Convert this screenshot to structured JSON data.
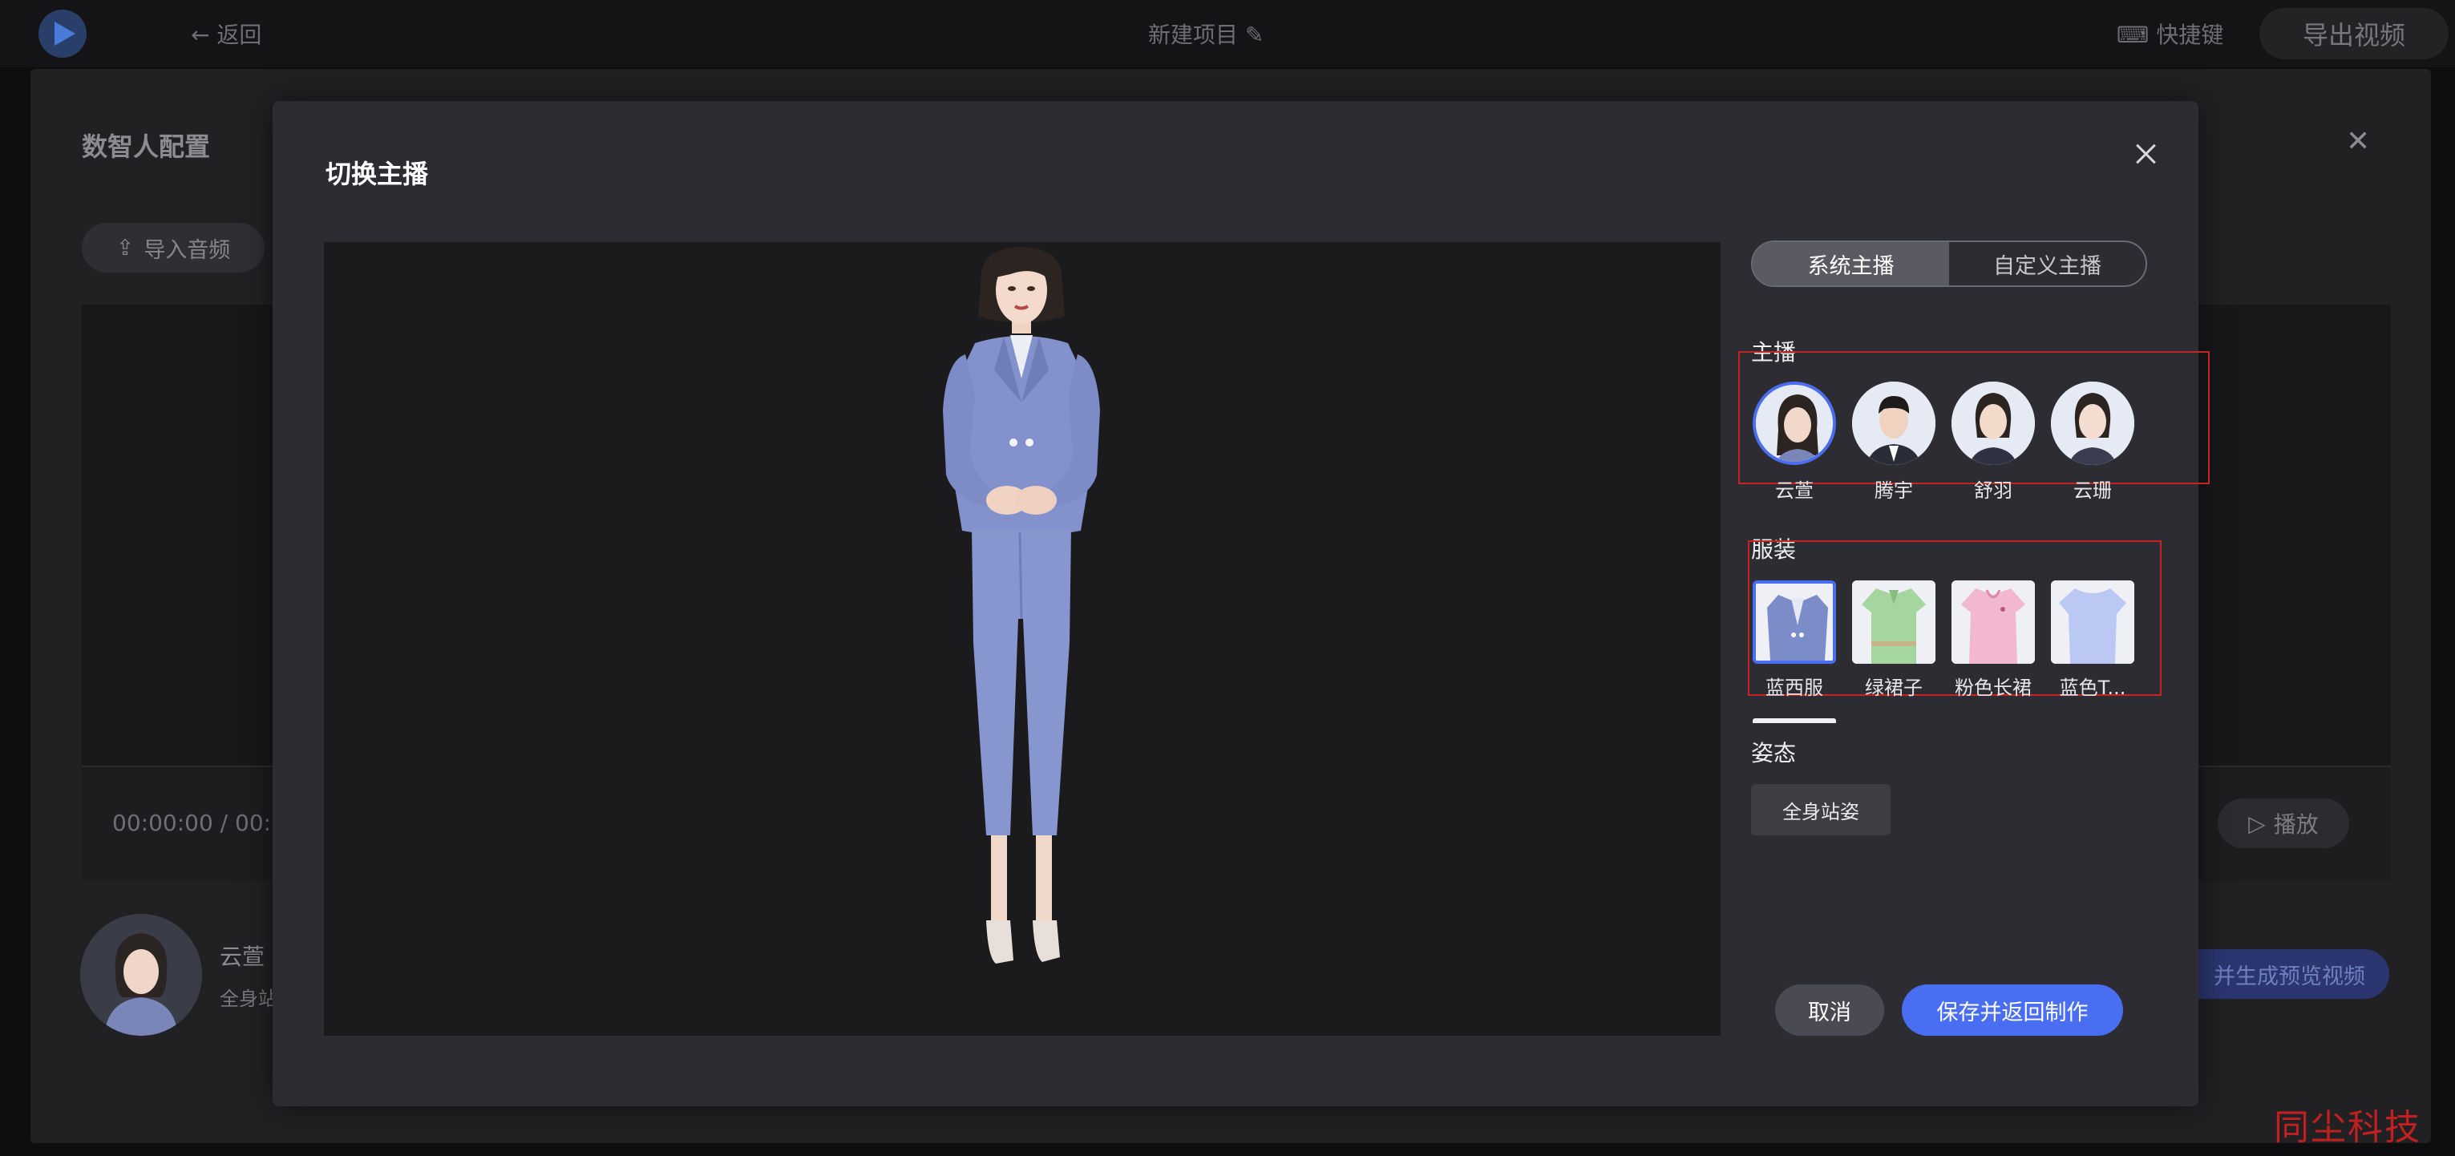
{
  "topbar": {
    "back_label": "返回",
    "project_name": "新建项目",
    "shortcut_label": "快捷键",
    "export_label": "导出视频"
  },
  "background_dialog": {
    "title": "数智人配置",
    "import_audio_label": "导入音频",
    "time_current": "00:00:00",
    "time_separator": "/",
    "time_total_partial": "00:",
    "play_label": "播放",
    "anchor_name": "云萱",
    "anchor_pose_partial": "全身站",
    "generate_label_partial": "并生成预览视频"
  },
  "modal": {
    "title": "切换主播",
    "tabs": [
      {
        "label": "系统主播",
        "active": true
      },
      {
        "label": "自定义主播",
        "active": false
      }
    ],
    "anchor_section_label": "主播",
    "anchors": [
      {
        "name": "云萱",
        "selected": true,
        "gender": "female"
      },
      {
        "name": "腾宇",
        "selected": false,
        "gender": "male"
      },
      {
        "name": "舒羽",
        "selected": false,
        "gender": "female"
      },
      {
        "name": "云珊",
        "selected": false,
        "gender": "female"
      }
    ],
    "outfit_section_label": "服装",
    "outfits": [
      {
        "name": "蓝西服",
        "selected": true,
        "color": "#7b8cc9"
      },
      {
        "name": "绿裙子",
        "selected": false,
        "color": "#a6d6a0"
      },
      {
        "name": "粉色长裙",
        "selected": false,
        "color": "#f2b8cf"
      },
      {
        "name": "蓝色T...",
        "selected": false,
        "color": "#bcc8f4"
      }
    ],
    "pose_section_label": "姿态",
    "pose_option": "全身站姿",
    "cancel_label": "取消",
    "save_label": "保存并返回制作"
  },
  "colors": {
    "accent": "#4a6ef2",
    "highlight_box": "#c82323",
    "suit": "#8391cc"
  },
  "watermark": "同尘科技"
}
